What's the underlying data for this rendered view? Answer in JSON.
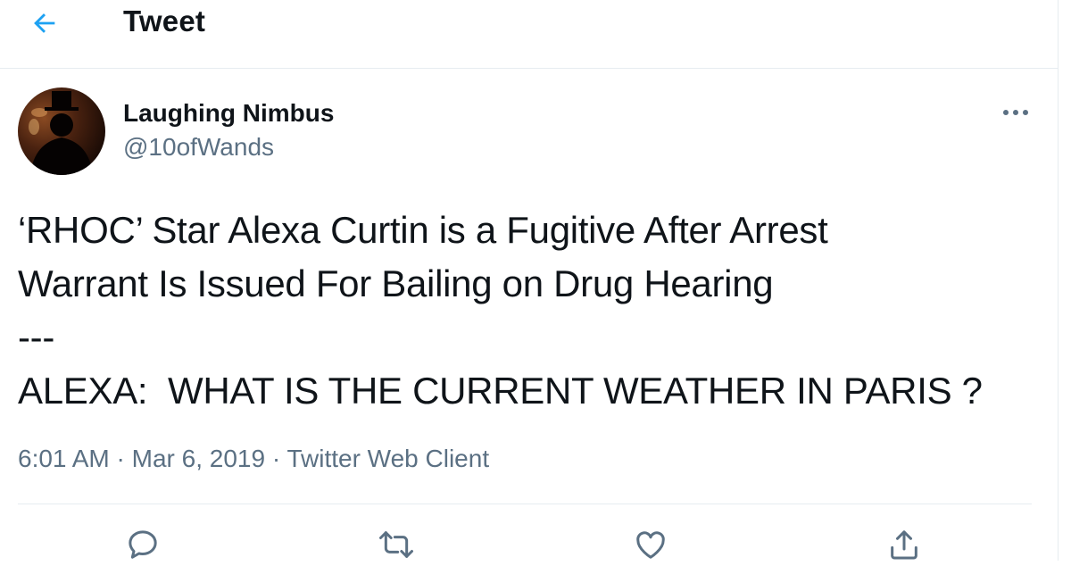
{
  "header": {
    "title": "Tweet",
    "back_icon": "arrow-left-icon",
    "accent": "#1da1f2"
  },
  "tweet": {
    "author": {
      "display_name": "Laughing Nimbus",
      "handle": "@10ofWands"
    },
    "text_lines": [
      "‘RHOC’ Star Alexa Curtin is a Fugitive After Arrest",
      "Warrant Is Issued For Bailing on Drug Hearing",
      "---",
      "ALEXA:  WHAT IS THE CURRENT WEATHER IN PARIS ?"
    ],
    "time": "6:01 AM",
    "date": "Mar 6, 2019",
    "separator": "·",
    "source": "Twitter Web Client",
    "more_icon": "more-horizontal-icon"
  },
  "actions": [
    {
      "name": "reply",
      "icon": "reply-icon"
    },
    {
      "name": "retweet",
      "icon": "retweet-icon"
    },
    {
      "name": "like",
      "icon": "heart-icon"
    },
    {
      "name": "share",
      "icon": "share-icon"
    }
  ],
  "colors": {
    "text": "#0f1419",
    "secondary": "#5b7083",
    "divider": "#e6ecf0"
  }
}
